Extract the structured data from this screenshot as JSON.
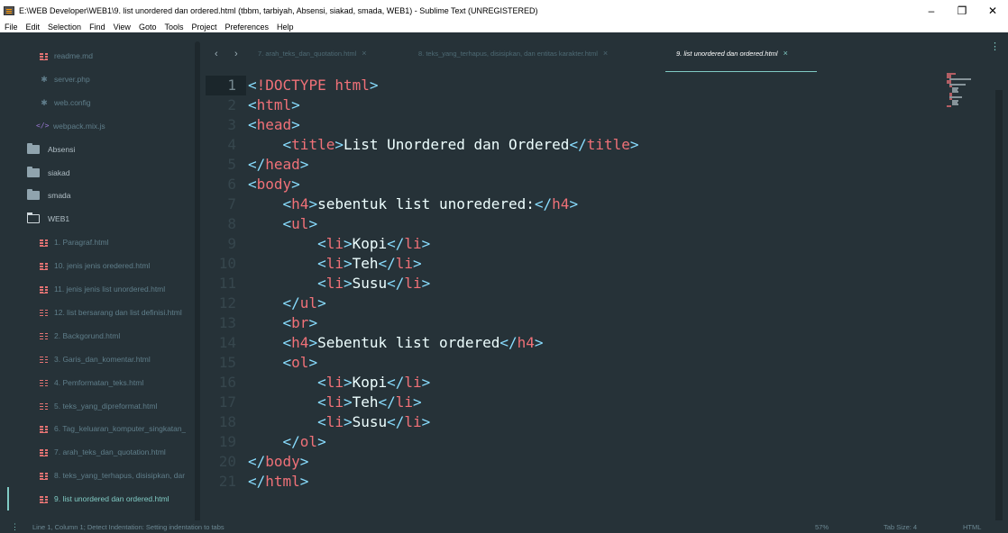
{
  "window": {
    "title": "E:\\WEB Developer\\WEB1\\9. list unordered dan ordered.html (tbbm, tarbiyah, Absensi, siakad, smada, WEB1) - Sublime Text (UNREGISTERED)",
    "minimize": "–",
    "maximize": "❐",
    "close": "✕"
  },
  "menu": [
    "File",
    "Edit",
    "Selection",
    "Find",
    "View",
    "Goto",
    "Tools",
    "Project",
    "Preferences",
    "Help"
  ],
  "sidebar": {
    "items": [
      {
        "label": "readme.md",
        "icon": "html-icon",
        "type": "file"
      },
      {
        "label": "server.php",
        "icon": "gear-icon",
        "type": "file"
      },
      {
        "label": "web.config",
        "icon": "gear-icon",
        "type": "file"
      },
      {
        "label": "webpack.mix.js",
        "icon": "code-icon",
        "type": "file"
      },
      {
        "label": "Absensi",
        "icon": "folder-icon",
        "type": "folder"
      },
      {
        "label": "siakad",
        "icon": "folder-icon",
        "type": "folder"
      },
      {
        "label": "smada",
        "icon": "folder-icon",
        "type": "folder"
      },
      {
        "label": "WEB1",
        "icon": "folder-open-icon",
        "type": "folder-open"
      },
      {
        "label": "1. Paragraf.html",
        "icon": "html-icon",
        "type": "file"
      },
      {
        "label": "10. jenis jenis oredered.html",
        "icon": "html-icon",
        "type": "file"
      },
      {
        "label": "11. jenis jenis list unordered.html",
        "icon": "html-icon",
        "type": "file"
      },
      {
        "label": "12. list bersarang dan list definisi.html",
        "icon": "html-icon",
        "type": "file"
      },
      {
        "label": "2. Backgorund.html",
        "icon": "html-icon",
        "type": "file"
      },
      {
        "label": "3. Garis_dan_komentar.html",
        "icon": "html-icon",
        "type": "file"
      },
      {
        "label": "4. Pemformatan_teks.html",
        "icon": "html-icon",
        "type": "file"
      },
      {
        "label": "5. teks_yang_dipreformat.html",
        "icon": "html-icon",
        "type": "file"
      },
      {
        "label": "6. Tag_keluaran_komputer_singkatan_",
        "icon": "html-icon",
        "type": "file"
      },
      {
        "label": "7. arah_teks_dan_quotation.html",
        "icon": "html-icon",
        "type": "file"
      },
      {
        "label": "8. teks_yang_terhapus, disisipkan, dar",
        "icon": "html-icon",
        "type": "file"
      },
      {
        "label": "9. list unordered dan ordered.html",
        "icon": "html-icon",
        "type": "file",
        "active": true
      }
    ]
  },
  "tabs": {
    "nav_prev": "‹",
    "nav_next": "›",
    "items": [
      {
        "label": "7. arah_teks_dan_quotation.html",
        "close": "×"
      },
      {
        "label": "8. teks_yang_terhapus, disisipkan, dan entitas karakter.html",
        "close": "×"
      },
      {
        "label": "9. list unordered dan ordered.html",
        "close": "×",
        "active": true
      }
    ],
    "more": "⋮"
  },
  "editor": {
    "lines": [
      "<!DOCTYPE html>",
      "<html>",
      "<head>",
      "    <title>List Unordered dan Ordered</title>",
      "</head>",
      "<body>",
      "    <h4>sebentuk list unoredered:</h4>",
      "    <ul>",
      "        <li>Kopi</li>",
      "        <li>Teh</li>",
      "        <li>Susu</li>",
      "    </ul>",
      "    <br>",
      "    <h4>Sebentuk list ordered</h4>",
      "    <ol>",
      "        <li>Kopi</li>",
      "        <li>Teh</li>",
      "        <li>Susu</li>",
      "    </ol>",
      "</body>",
      "</html>"
    ],
    "current_line": 1
  },
  "status": {
    "menu_icon": "⋮",
    "message": "Line 1, Column 1; Detect Indentation: Setting indentation to tabs",
    "zoom": "57%",
    "tab_size": "Tab Size: 4",
    "syntax": "HTML"
  },
  "colors": {
    "background": "#263238",
    "accent": "#80cbc4",
    "tag": "#f07178",
    "punctuation": "#89ddff",
    "text": "#eeffff"
  }
}
